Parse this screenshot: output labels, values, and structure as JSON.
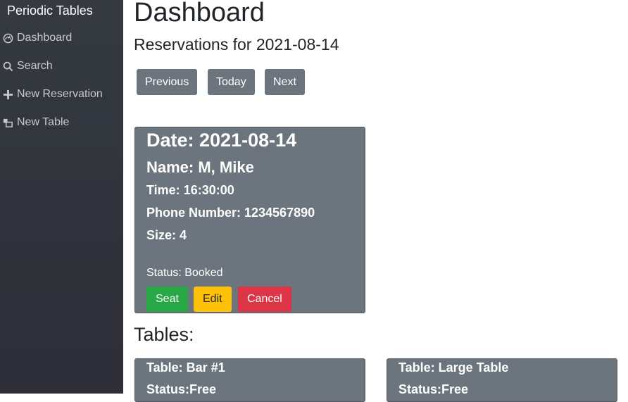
{
  "sidebar": {
    "brand": "Periodic Tables",
    "items": [
      {
        "label": "Dashboard",
        "icon": "dashboard-icon"
      },
      {
        "label": "Search",
        "icon": "search-icon"
      },
      {
        "label": "New Reservation",
        "icon": "plus-icon"
      },
      {
        "label": "New Table",
        "icon": "layers-icon"
      }
    ]
  },
  "main": {
    "title": "Dashboard",
    "subtitle": "Reservations for 2021-08-14",
    "nav_buttons": {
      "previous": "Previous",
      "today": "Today",
      "next": "Next"
    },
    "reservation": {
      "date": "Date: 2021-08-14",
      "name": "Name: M, Mike",
      "time": "Time: 16:30:00",
      "phone": "Phone Number: 1234567890",
      "size": "Size: 4",
      "status": "Status: Booked",
      "seat_label": "Seat",
      "edit_label": "Edit",
      "cancel_label": "Cancel"
    },
    "tables_heading": "Tables:",
    "tables": [
      {
        "label": "Table: Bar #1",
        "status": "Status:Free"
      },
      {
        "label": "Table: Large Table",
        "status": "Status:Free"
      }
    ]
  },
  "colors": {
    "sidebar_bg": "#343a40",
    "card_bg": "#6c757d",
    "seat": "#28a745",
    "edit": "#ffc107",
    "cancel": "#dc3545"
  }
}
